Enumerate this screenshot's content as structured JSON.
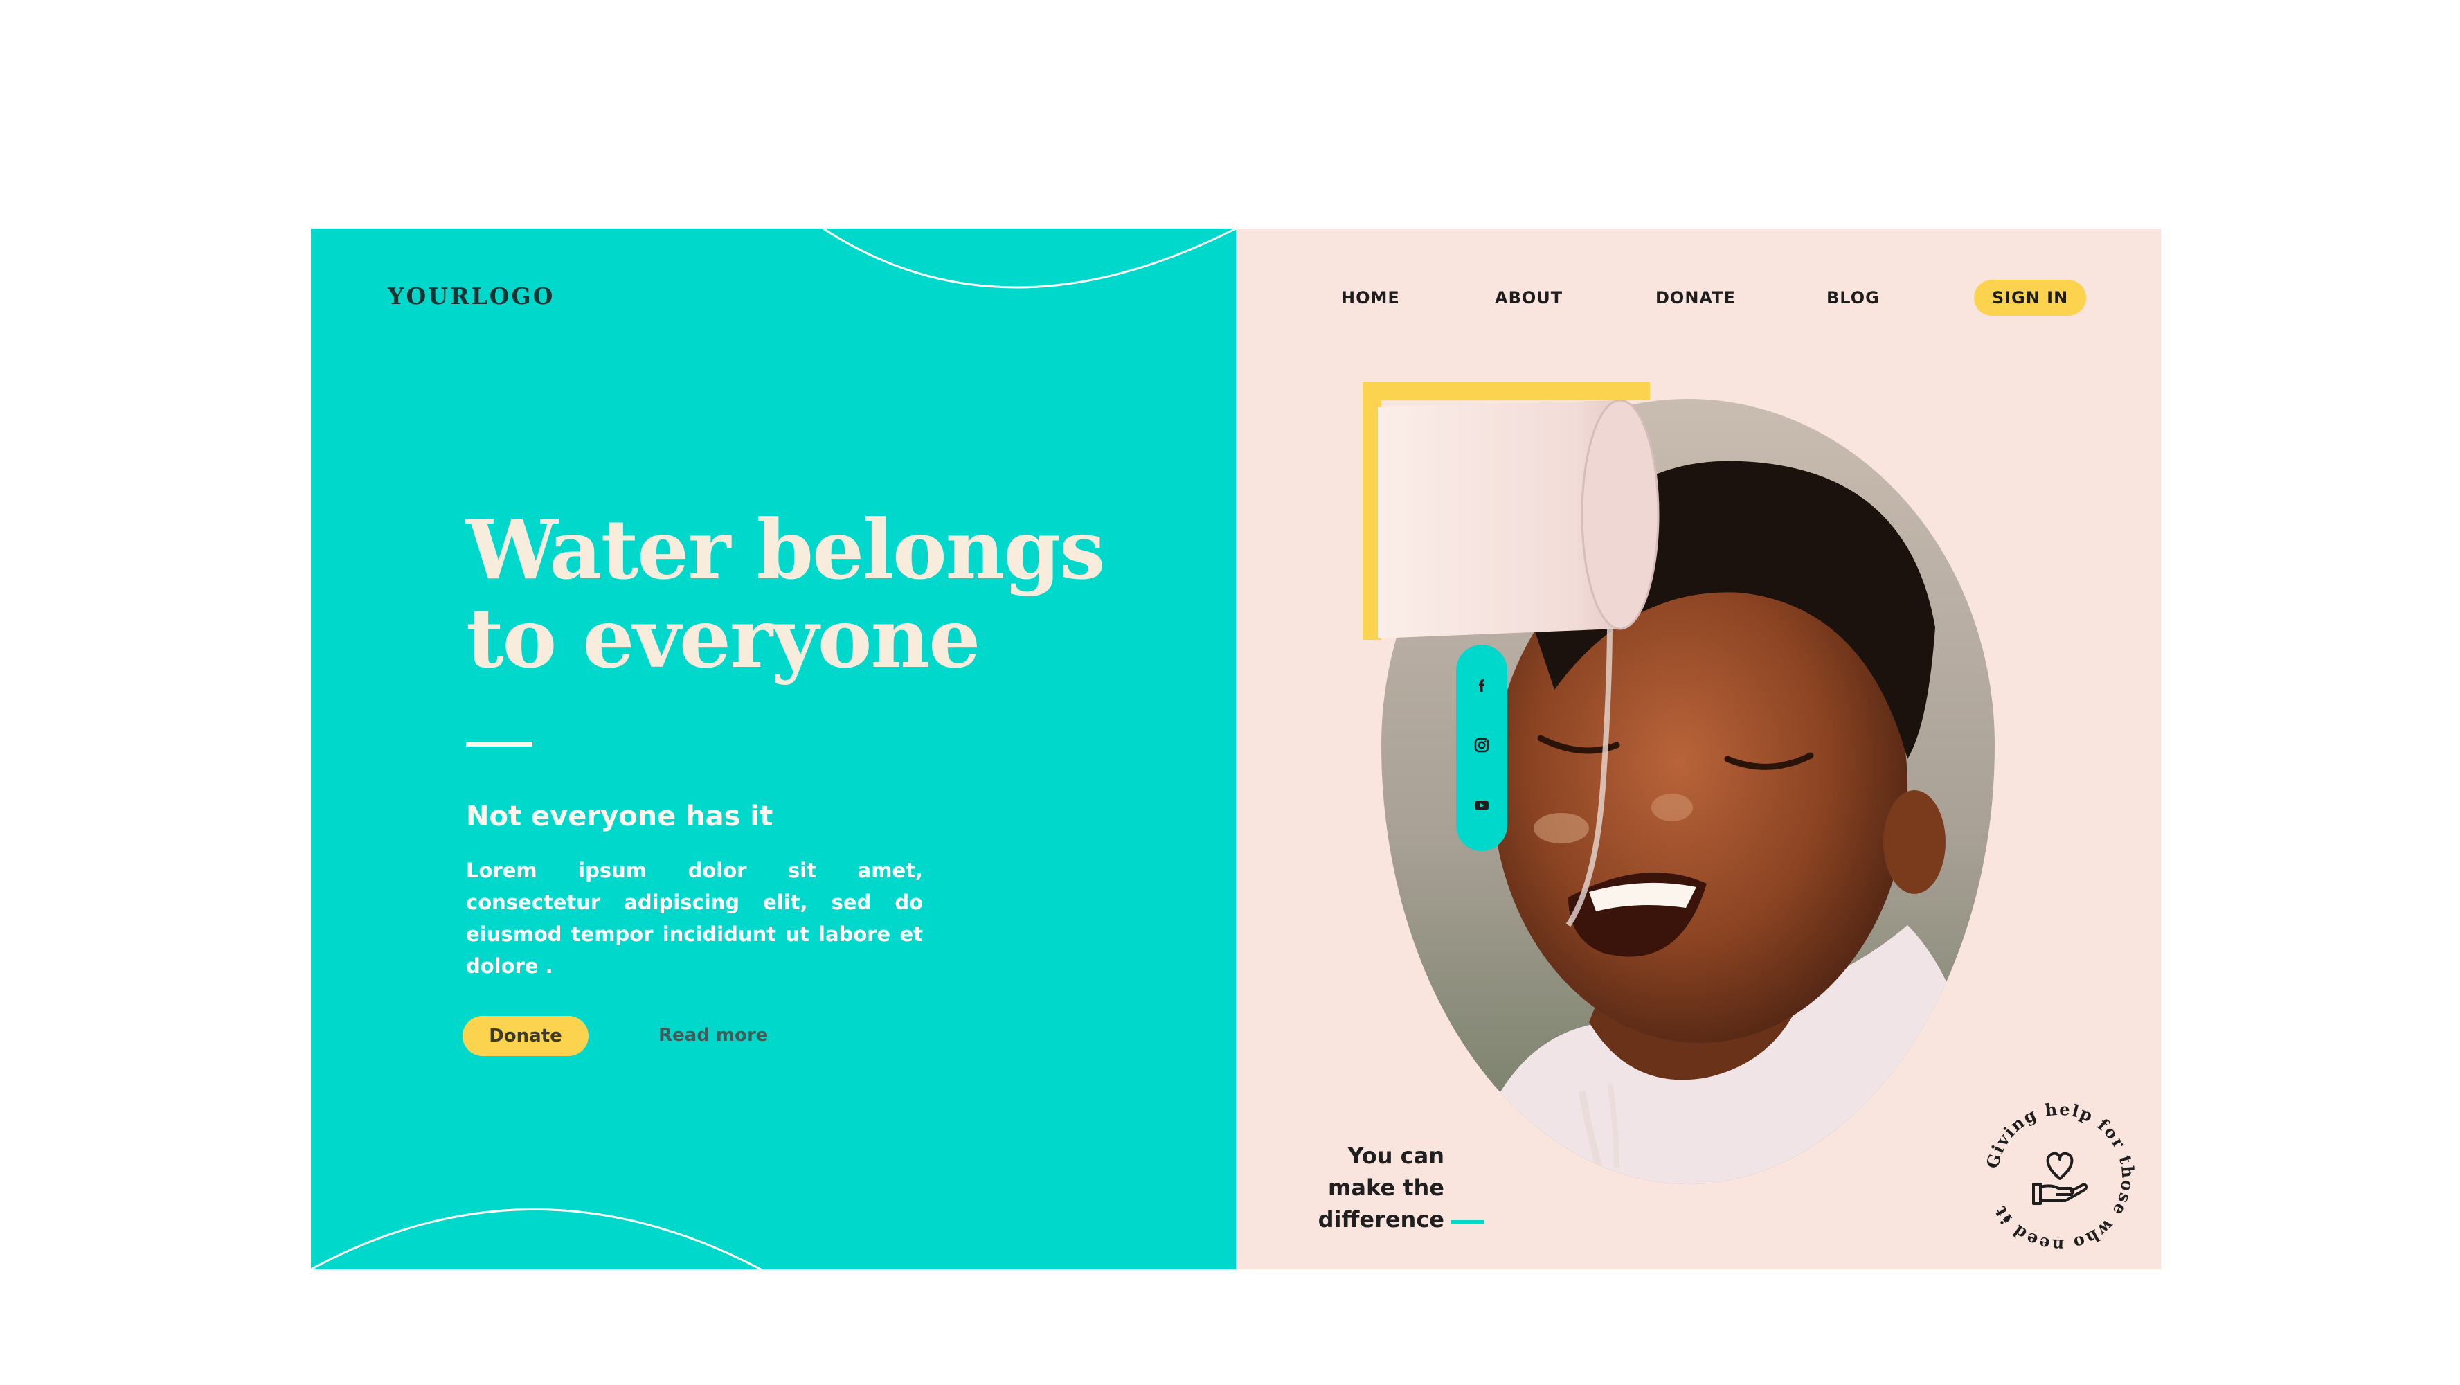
{
  "logo": "YOURLOGO",
  "hero": {
    "headline_line1": "Water belongs",
    "headline_line2": "to everyone",
    "subhead": "Not everyone has it",
    "body": "Lorem ipsum dolor sit amet, consectetur adipiscing elit, sed do eiusmod tempor incididunt ut labore et dolore ."
  },
  "buttons": {
    "donate": "Donate",
    "read_more": "Read more"
  },
  "nav": {
    "items": [
      "HOME",
      "ABOUT",
      "DONATE",
      "BLOG"
    ],
    "sign_in": "SIGN IN"
  },
  "cta": {
    "line1": "You can",
    "line2": "make the",
    "line3": "difference"
  },
  "badge": {
    "text": "Giving help for those who need it"
  },
  "social": {
    "icons": [
      "facebook-icon",
      "instagram-icon",
      "youtube-icon"
    ]
  },
  "colors": {
    "teal": "#00d8cb",
    "peach": "#fae5de",
    "yellow": "#fbd34e",
    "cream": "#f8ecdd"
  }
}
